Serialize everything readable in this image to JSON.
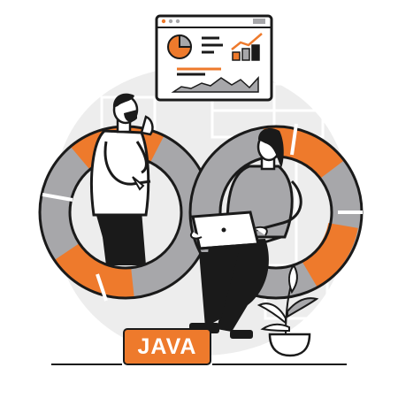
{
  "illustration": {
    "badge": {
      "label": "JAVA"
    },
    "colors": {
      "accent": "#EE7A2C",
      "gray": "#A7A7AA",
      "light_gray": "#DADADA",
      "background_circle": "#EDEDED",
      "ink": "#1A1A1A",
      "white": "#FFFFFF"
    },
    "icons": [
      "dashboard-window",
      "pie-chart-icon",
      "bar-chart-icon",
      "area-chart-icon",
      "infinity-loop",
      "laptop-icon",
      "potted-plant-icon"
    ]
  }
}
